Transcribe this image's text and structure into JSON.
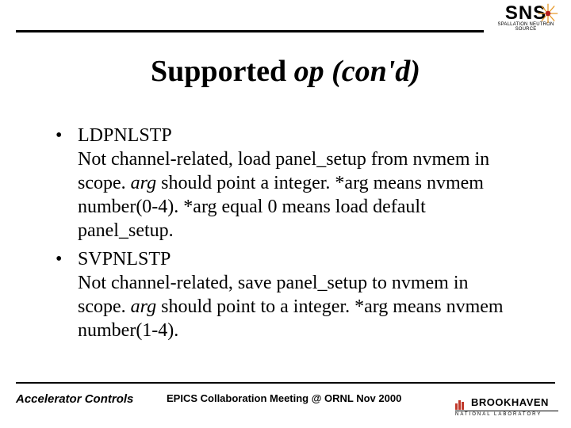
{
  "header": {
    "logo_main": "SNS",
    "logo_sub": "SPALLATION NEUTRON SOURCE"
  },
  "title": {
    "prefix": "Supported ",
    "italic": "op (con'd)"
  },
  "bullets": [
    {
      "head": "LDPNLSTP",
      "body_parts": [
        "Not channel-related, load panel_setup from nvmem in scope. ",
        "arg",
        " should point a integer. *arg means nvmem number(0-4). *arg equal 0 means load default panel_setup."
      ]
    },
    {
      "head": "SVPNLSTP",
      "body_parts": [
        "Not channel-related, save panel_setup to nvmem in scope. ",
        "arg",
        " should point to a integer. *arg means nvmem number(1-4)."
      ]
    }
  ],
  "footer": {
    "left": "Accelerator Controls",
    "mid": "EPICS Collaboration Meeting @ ORNL Nov 2000",
    "bnl_main": "BROOKHAVEN",
    "bnl_sub": "NATIONAL LABORATORY"
  }
}
